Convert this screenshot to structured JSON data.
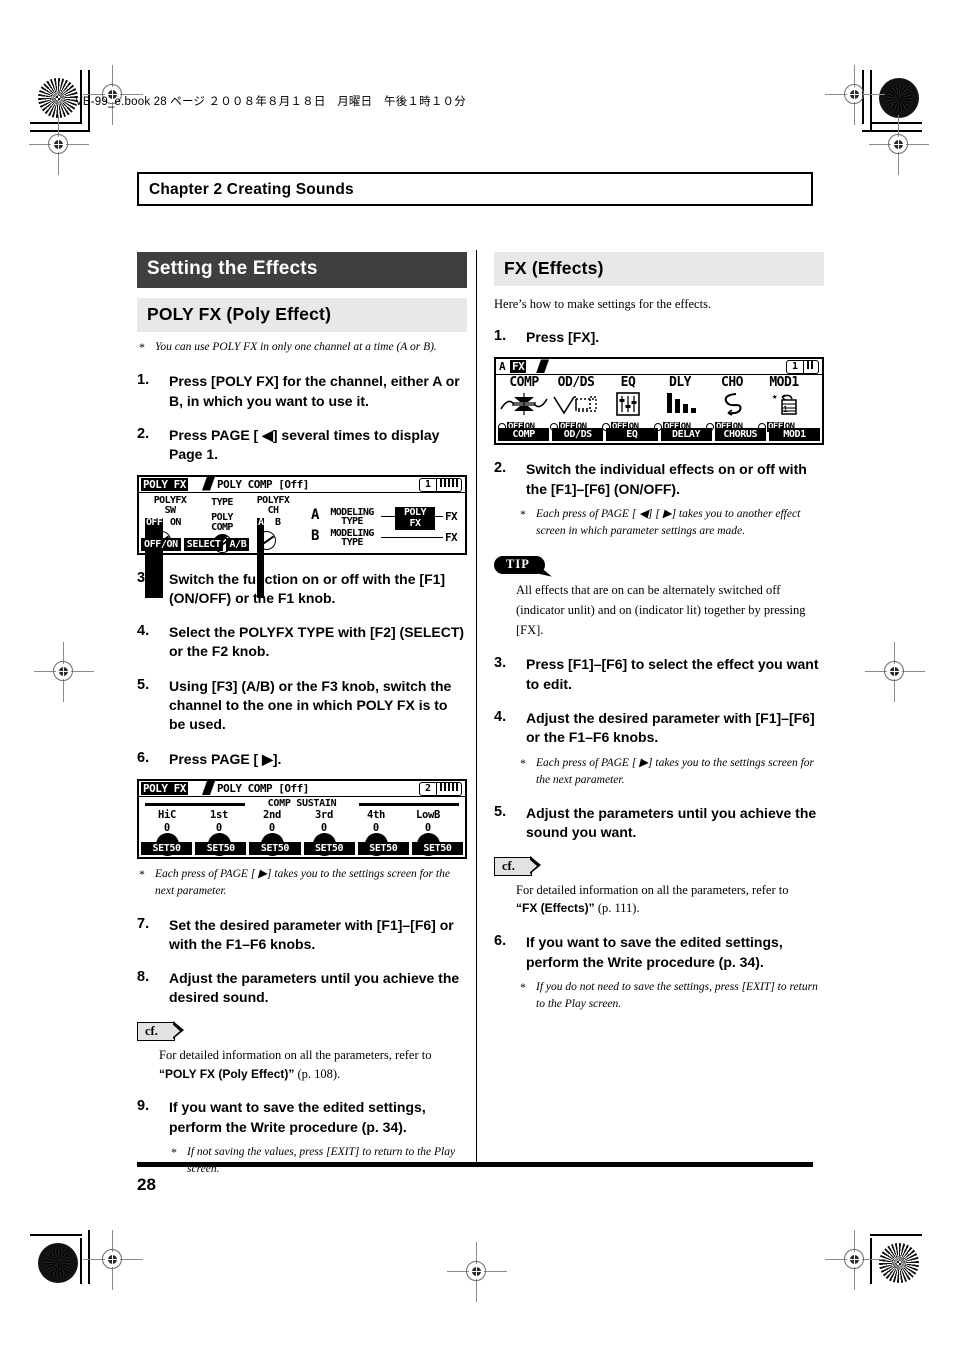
{
  "print": {
    "file_stamp": "VB-99_e.book 28 ページ ２００８年８月１８日　月曜日　午後１時１０分"
  },
  "header": {
    "chapter": "Chapter 2 Creating Sounds"
  },
  "left_column": {
    "section_title": "Setting the Effects",
    "subsection_title": "POLY FX (Poly Effect)",
    "note_top": "You can use POLY FX in only one channel at a time (A or B).",
    "steps": [
      {
        "num": "1.",
        "text": "Press [POLY FX] for the channel, either A or B, in which you want to use it."
      },
      {
        "num": "2.",
        "text": "Press PAGE [ ◀] several times to display Page 1."
      },
      {
        "num": "3.",
        "text": "Switch the function on or off with the [F1] (ON/OFF) or the F1 knob."
      },
      {
        "num": "4.",
        "text": "Select the POLYFX TYPE with [F2] (SELECT) or the F2 knob."
      },
      {
        "num": "5.",
        "text": "Using [F3] (A/B) or the F3 knob, switch the channel to the one in which POLY FX is to be used."
      },
      {
        "num": "6.",
        "text": "Press PAGE [ ▶]."
      },
      {
        "num": "7.",
        "text": "Set the desired parameter with [F1]–[F6] or with the F1–F6 knobs."
      },
      {
        "num": "8.",
        "text": "Adjust the parameters until you achieve the desired sound."
      },
      {
        "num": "9.",
        "text": "If you want to save the edited settings, perform the Write procedure (p. 34)."
      }
    ],
    "note_after_step6": "Each press of PAGE [ ▶] takes you to the settings screen for the next parameter.",
    "cf_badge": "cf.",
    "cf_text_1": "For detailed information on all the parameters, refer to",
    "cf_ref_bold": "“POLY FX (Poly Effect)”",
    "cf_ref_page": " (p. 108).",
    "note_final": "If not saving the values, press [EXIT] to return to the Play screen."
  },
  "right_column": {
    "section_title": "FX (Effects)",
    "intro": "Here’s how to make settings for the effects.",
    "steps": [
      {
        "num": "1.",
        "text": "Press [FX]."
      },
      {
        "num": "2.",
        "text": "Switch the individual effects on or off with the [F1]–[F6] (ON/OFF)."
      },
      {
        "num": "3.",
        "text": "Press [F1]–[F6] to select the effect you want to edit."
      },
      {
        "num": "4.",
        "text": "Adjust the desired parameter with [F1]–[F6] or the F1–F6 knobs."
      },
      {
        "num": "5.",
        "text": "Adjust the parameters until you achieve the sound you want."
      },
      {
        "num": "6.",
        "text": "If you want to save the edited settings, perform the Write procedure (p. 34)."
      }
    ],
    "note_after_step2": "Each press of PAGE [ ◀] [ ▶] takes you to another effect screen in which parameter settings are made.",
    "tip_badge": "TIP",
    "tip_text": "All effects that are on can be alternately switched off (indicator unlit) and on (indicator lit) together by pressing [FX].",
    "note_after_step4": "Each press of PAGE [ ▶] takes you to the settings screen for the next parameter.",
    "cf_badge": "cf.",
    "cf_text_1": "For detailed information on all the parameters, refer to",
    "cf_ref_bold": "“FX (Effects)”",
    "cf_ref_page": " (p. 111).",
    "note_final": "If you do not need to save the settings, press [EXIT] to return to the Play screen."
  },
  "lcd_polyfx_page1": {
    "title_inverse": "POLY FX",
    "title_rest": "POLY COMP [Off]",
    "page_number": "1",
    "labels": {
      "sw_l1": "POLYFX",
      "sw_l2": "SW",
      "sw_off": "OFF",
      "sw_on": "ON",
      "type": "TYPE",
      "type_v1": "POLY",
      "type_v2": "COMP",
      "ch_l1": "POLYFX",
      "ch_l2": "CH",
      "ch_a": "A",
      "ch_b": "B",
      "chan_a": "A",
      "chan_b": "B",
      "modeling1": "MODELING",
      "modeling2": "TYPE",
      "polyfx_box1": "POLY",
      "polyfx_box2": "FX",
      "fx_out": "FX"
    },
    "softkeys": [
      "OFF/ON",
      "SELECT",
      "A/B"
    ]
  },
  "lcd_polyfx_page2": {
    "title_inverse": "POLY FX",
    "title_rest": "POLY COMP [Off]",
    "page_number": "2",
    "group_header": "COMP SUSTAIN",
    "params": [
      {
        "name": "HiC",
        "value": "0"
      },
      {
        "name": "1st",
        "value": "0"
      },
      {
        "name": "2nd",
        "value": "0"
      },
      {
        "name": "3rd",
        "value": "0"
      },
      {
        "name": "4th",
        "value": "0"
      },
      {
        "name": "LowB",
        "value": "0"
      }
    ],
    "softkeys": [
      "SET50",
      "SET50",
      "SET50",
      "SET50",
      "SET50",
      "SET50"
    ]
  },
  "lcd_fx": {
    "title_channel": "A",
    "title_inverse": "FX",
    "page_number": "1",
    "effects": [
      {
        "name": "COMP",
        "icon": "compressor-icon",
        "state_off": "OFF",
        "state_on": "ON",
        "softkey": "COMP"
      },
      {
        "name": "OD/DS",
        "icon": "overdrive-icon",
        "state_off": "OFF",
        "state_on": "ON",
        "softkey": "OD/DS"
      },
      {
        "name": "EQ",
        "icon": "equalizer-icon",
        "state_off": "OFF",
        "state_on": "ON",
        "softkey": "EQ"
      },
      {
        "name": "DLY",
        "icon": "delay-icon",
        "state_off": "OFF",
        "state_on": "ON",
        "softkey": "DELAY"
      },
      {
        "name": "CHO",
        "icon": "chorus-icon",
        "state_off": "OFF",
        "state_on": "ON",
        "softkey": "CHORUS"
      },
      {
        "name": "MOD1",
        "icon": "modulation-icon",
        "state_off": "OFF",
        "state_on": "ON",
        "softkey": "MOD1"
      }
    ]
  },
  "footer": {
    "page_number": "28"
  },
  "colors": {
    "section_bar": "#3f3f3f",
    "subsection_bar": "#e8e8e8",
    "text": "#000000",
    "paper": "#ffffff"
  }
}
